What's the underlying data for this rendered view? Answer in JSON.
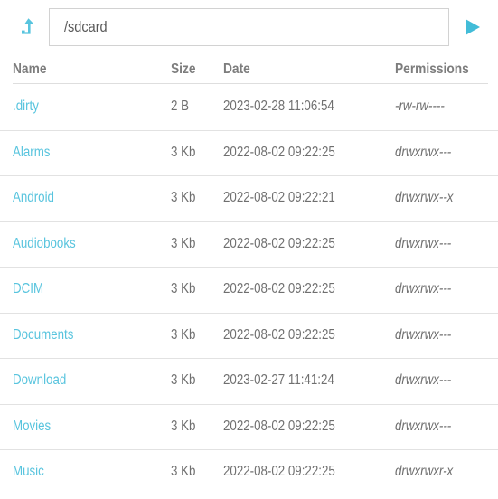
{
  "toolbar": {
    "up_icon": "arrow-up-icon",
    "go_icon": "play-triangle-icon",
    "path_value": "/sdcard",
    "path_placeholder": "/sdcard"
  },
  "colors": {
    "accent": "#58c4de",
    "text": "#6f6f6f",
    "header_text": "#7d7d7d",
    "border": "#d2d2d2",
    "row_divider": "#e2e2e2",
    "background": "#ffffff"
  },
  "table": {
    "columns": [
      {
        "key": "name",
        "label": "Name"
      },
      {
        "key": "size",
        "label": "Size"
      },
      {
        "key": "date",
        "label": "Date"
      },
      {
        "key": "permissions",
        "label": "Permissions"
      }
    ],
    "rows": [
      {
        "name": ".dirty",
        "size": "2 B",
        "date": "2023-02-28 11:06:54",
        "permissions": "-rw-rw----"
      },
      {
        "name": "Alarms",
        "size": "3 Kb",
        "date": "2022-08-02 09:22:25",
        "permissions": "drwxrwx---"
      },
      {
        "name": "Android",
        "size": "3 Kb",
        "date": "2022-08-02 09:22:21",
        "permissions": "drwxrwx--x"
      },
      {
        "name": "Audiobooks",
        "size": "3 Kb",
        "date": "2022-08-02 09:22:25",
        "permissions": "drwxrwx---"
      },
      {
        "name": "DCIM",
        "size": "3 Kb",
        "date": "2022-08-02 09:22:25",
        "permissions": "drwxrwx---"
      },
      {
        "name": "Documents",
        "size": "3 Kb",
        "date": "2022-08-02 09:22:25",
        "permissions": "drwxrwx---"
      },
      {
        "name": "Download",
        "size": "3 Kb",
        "date": "2023-02-27 11:41:24",
        "permissions": "drwxrwx---"
      },
      {
        "name": "Movies",
        "size": "3 Kb",
        "date": "2022-08-02 09:22:25",
        "permissions": "drwxrwx---"
      },
      {
        "name": "Music",
        "size": "3 Kb",
        "date": "2022-08-02 09:22:25",
        "permissions": "drwxrwxr-x"
      }
    ]
  }
}
